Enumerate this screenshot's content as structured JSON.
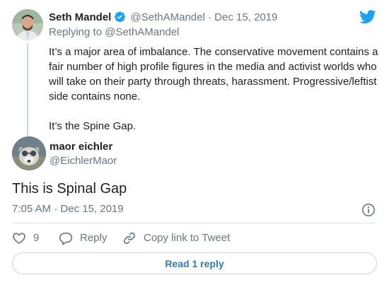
{
  "parent_tweet": {
    "author_name": "Seth Mandel",
    "author_handle": "@SethAMandel",
    "separator": "·",
    "date": "Dec 15, 2019",
    "replying_prefix": "Replying to",
    "replying_handle": "@SethAMandel",
    "paragraph_1": "It’s a major area of imbalance. The conservative movement contains a fair number of high profile figures in the media and activist worlds who will take on their party through threats, harassment. Progressive/leftist side contains none.",
    "paragraph_2": "It’s the Spine Gap."
  },
  "main_tweet": {
    "author_name": "maor eichler",
    "author_handle": "@EichlerMaor",
    "text": "This is Spinal Gap",
    "time": "7:05 AM",
    "separator": "·",
    "date": "Dec 15, 2019"
  },
  "actions": {
    "like_count": "9",
    "reply_label": "Reply",
    "copy_link_label": "Copy link to Tweet"
  },
  "read_replies_label": "Read 1 reply",
  "colors": {
    "brand": "#1da1f2",
    "text": "#1c2022",
    "muted": "#697882",
    "link": "#2b7bb9",
    "verified": "#1da1f2"
  },
  "icons": [
    "twitter-bird-icon",
    "verified-badge-icon",
    "info-icon",
    "heart-icon",
    "reply-icon",
    "copy-link-icon"
  ]
}
